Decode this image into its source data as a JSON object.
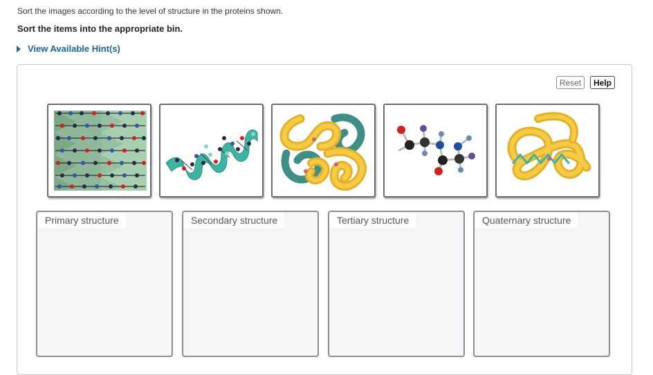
{
  "instruction": "Sort the images according to the level of structure in the proteins shown.",
  "subinstruction": "Sort the items into the appropriate bin.",
  "hint": {
    "label": "View Available Hint(s)",
    "icon": "caret-right-icon"
  },
  "toolbar": {
    "reset_label": "Reset",
    "help_label": "Help"
  },
  "cards": [
    {
      "icon": "beta-pleated-sheet-image"
    },
    {
      "icon": "alpha-helix-image"
    },
    {
      "icon": "multi-subunit-protein-image"
    },
    {
      "icon": "amino-acid-chain-image"
    },
    {
      "icon": "folded-protein-image"
    }
  ],
  "bins": [
    {
      "label": "Primary structure"
    },
    {
      "label": "Secondary structure"
    },
    {
      "label": "Tertiary structure"
    },
    {
      "label": "Quaternary structure"
    }
  ],
  "colors": {
    "link": "#1a6496",
    "bin_bg": "#f6f6f7",
    "gold": "#f2bf2a",
    "teal": "#3fa99a"
  }
}
